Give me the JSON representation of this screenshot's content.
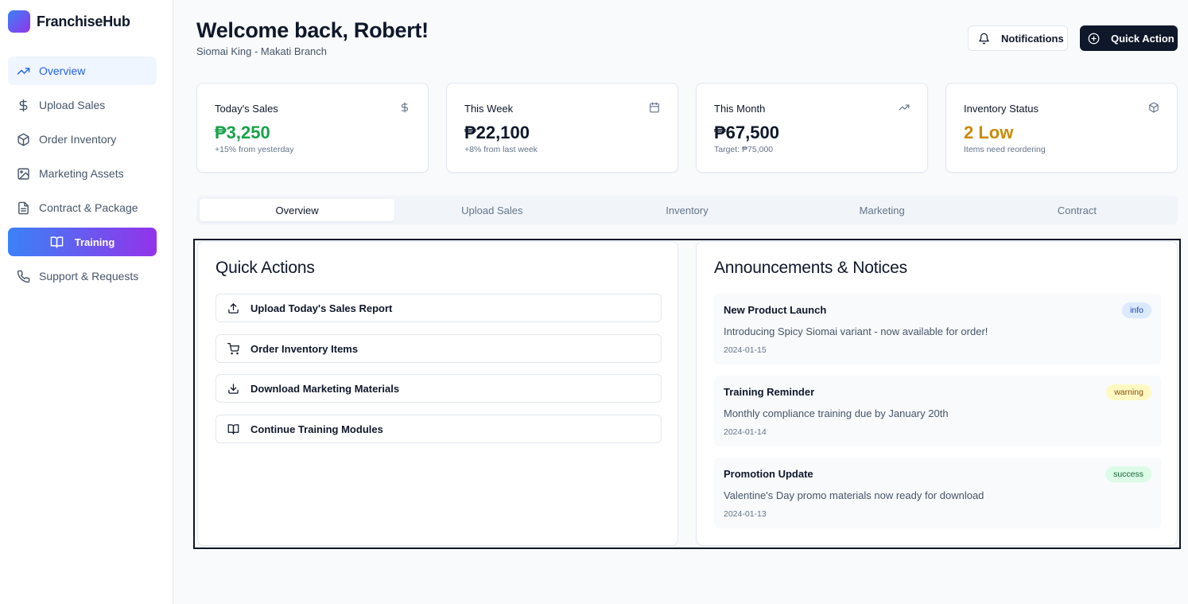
{
  "brand": {
    "name": "FranchiseHub",
    "colors": {
      "gradient_start": "#3b82f6",
      "gradient_end": "#9333ea"
    }
  },
  "sidebar": {
    "items": [
      {
        "label": "Overview",
        "icon": "trending-up-icon"
      },
      {
        "label": "Upload Sales",
        "icon": "dollar-icon"
      },
      {
        "label": "Order Inventory",
        "icon": "package-icon"
      },
      {
        "label": "Marketing Assets",
        "icon": "image-icon"
      },
      {
        "label": "Contract & Package",
        "icon": "document-icon"
      },
      {
        "label": "Training",
        "icon": "book-icon"
      },
      {
        "label": "Support & Requests",
        "icon": "phone-icon"
      }
    ]
  },
  "header": {
    "title": "Welcome back, Robert!",
    "subtitle": "Siomai King - Makati Branch",
    "notifications_label": "Notifications",
    "quick_action_label": "Quick Action"
  },
  "stats": [
    {
      "label": "Today's Sales",
      "value": "₱3,250",
      "sub": "+15% from yesterday",
      "icon": "dollar-icon",
      "value_color": "#16a34a"
    },
    {
      "label": "This Week",
      "value": "₱22,100",
      "sub": "+8% from last week",
      "icon": "calendar-icon",
      "value_color": "#0f172a"
    },
    {
      "label": "This Month",
      "value": "₱67,500",
      "sub": "Target: ₱75,000",
      "icon": "trending-up-icon",
      "value_color": "#0f172a"
    },
    {
      "label": "Inventory Status",
      "value": "2 Low",
      "sub": "Items need reordering",
      "icon": "package-icon",
      "value_color": "#ca8a04"
    }
  ],
  "tabs": [
    "Overview",
    "Upload Sales",
    "Inventory",
    "Marketing",
    "Contract"
  ],
  "quick_actions": {
    "title": "Quick Actions",
    "items": [
      {
        "label": "Upload Today's Sales Report",
        "icon": "upload-icon"
      },
      {
        "label": "Order Inventory Items",
        "icon": "cart-icon"
      },
      {
        "label": "Download Marketing Materials",
        "icon": "download-icon"
      },
      {
        "label": "Continue Training Modules",
        "icon": "book-icon"
      }
    ]
  },
  "announcements": {
    "title": "Announcements & Notices",
    "items": [
      {
        "title": "New Product Launch",
        "body": "Introducing Spicy Siomai variant - now available for order!",
        "date": "2024-01-15",
        "badge": "info"
      },
      {
        "title": "Training Reminder",
        "body": "Monthly compliance training due by January 20th",
        "date": "2024-01-14",
        "badge": "warning"
      },
      {
        "title": "Promotion Update",
        "body": "Valentine's Day promo materials now ready for download",
        "date": "2024-01-13",
        "badge": "success"
      }
    ]
  }
}
